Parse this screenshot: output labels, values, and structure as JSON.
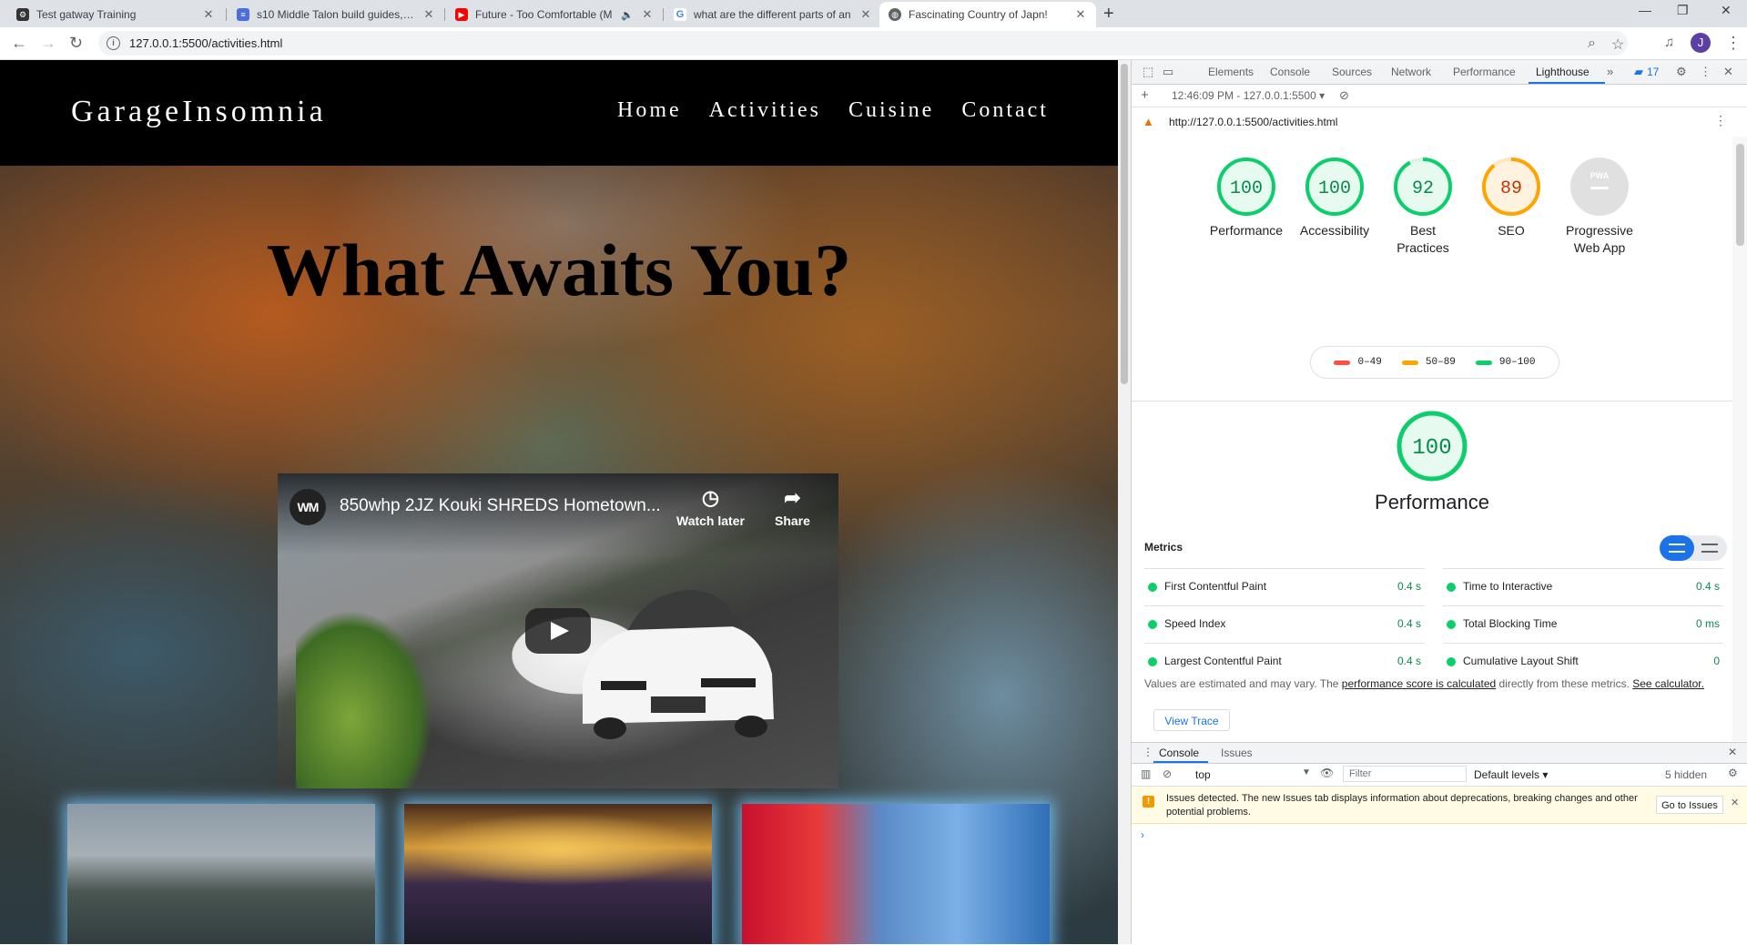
{
  "browser": {
    "tabs": [
      {
        "title": "Test gatway Training",
        "favicon": "gear-icon",
        "color": "#333333"
      },
      {
        "title": "s10 Middle Talon build guides, co",
        "favicon": "docs-icon",
        "color": "#4a6fdc"
      },
      {
        "title": "Future - Too Comfortable (M",
        "favicon": "youtube-icon",
        "color": "#ff0000"
      },
      {
        "title": "what are the different parts of an",
        "favicon": "google-icon",
        "color": "#4285f4"
      },
      {
        "title": "Fascinating Country of Japn!",
        "favicon": "globe-icon",
        "color": "#5f6368"
      }
    ],
    "url": "127.0.0.1:5500/activities.html",
    "profile_initial": "J"
  },
  "site": {
    "brand": "GarageInsomnia",
    "nav": [
      "Home",
      "Activities",
      "Cuisine",
      "Contact"
    ],
    "hero_title": "What Awaits You?",
    "video": {
      "channel_logo": "WM",
      "title": "850whp 2JZ Kouki SHREDS Hometown...",
      "watch_later": "Watch later",
      "share": "Share"
    }
  },
  "devtools": {
    "tabs": [
      "Elements",
      "Console",
      "Sources",
      "Network",
      "Performance",
      "Lighthouse"
    ],
    "active_tab": "Lighthouse",
    "issues_count": "17",
    "report_time": "12:46:09 PM - 127.0.0.1:5500",
    "audited_url": "http://127.0.0.1:5500/activities.html",
    "scores": [
      {
        "label": "Performance",
        "value": 100,
        "color": "#0cce6b"
      },
      {
        "label": "Accessibility",
        "value": 100,
        "color": "#0cce6b"
      },
      {
        "label": "Best Practices",
        "value": 92,
        "color": "#0cce6b"
      },
      {
        "label": "SEO",
        "value": 89,
        "color": "#ffa400"
      },
      {
        "label": "Progressive Web App",
        "value": null,
        "badge": "PWA",
        "color": "#cccccc"
      }
    ],
    "legend": [
      {
        "range": "0–49",
        "color": "#ff4e42"
      },
      {
        "range": "50–89",
        "color": "#ffa400"
      },
      {
        "range": "90–100",
        "color": "#0cce6b"
      }
    ],
    "main_score": {
      "label": "Performance",
      "value": 100
    },
    "metrics_heading": "Metrics",
    "metrics": [
      {
        "name": "First Contentful Paint",
        "value": "0.4 s"
      },
      {
        "name": "Time to Interactive",
        "value": "0.4 s"
      },
      {
        "name": "Speed Index",
        "value": "0.4 s"
      },
      {
        "name": "Total Blocking Time",
        "value": "0 ms"
      },
      {
        "name": "Largest Contentful Paint",
        "value": "0.4 s"
      },
      {
        "name": "Cumulative Layout Shift",
        "value": "0"
      }
    ],
    "note_prefix": "Values are estimated and may vary. The ",
    "note_link1": "performance score is calculated",
    "note_middle": " directly from these metrics. ",
    "note_link2": "See calculator.",
    "view_trace": "View Trace",
    "drawer": {
      "tabs": [
        "Console",
        "Issues"
      ],
      "context": "top",
      "filter_placeholder": "Filter",
      "levels": "Default levels ▾",
      "hidden": "5 hidden",
      "issue_text": "Issues detected. The new Issues tab displays information about deprecations, breaking changes and other potential problems.",
      "go_to_issues": "Go to Issues",
      "prompt": "›"
    }
  }
}
